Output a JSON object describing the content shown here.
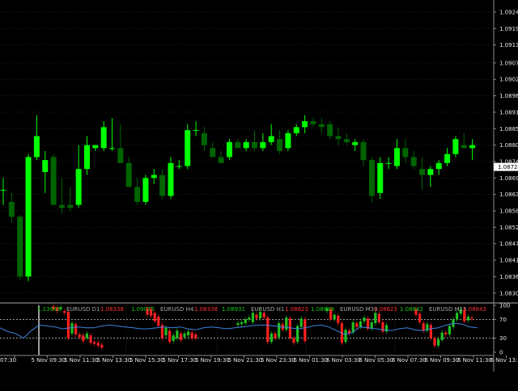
{
  "colors": {
    "background": "#000000",
    "grid": "#3a4a3a",
    "axis": "#8a8a8a",
    "bull": "#00ff00",
    "bear": "#006400",
    "current_price_bg": "#ffffff",
    "current_price_text": "#000000",
    "osc_line": "#3f82e0",
    "osc_level": "#cfcfcf",
    "ind_up": "#ff2020",
    "ind_down": "#20c020",
    "cursor_line": "#9a9a9a",
    "label_grey": "#a8a8a8",
    "label_red": "#ff3030",
    "label_green": "#19c819"
  },
  "price_axis": {
    "labels": [
      "1.09245",
      "1.09190",
      "1.09135",
      "1.09075",
      "1.09020",
      "1.08965",
      "1.08910",
      "1.08855",
      "1.08800",
      "1.08745",
      "1.08690",
      "1.08635",
      "1.08580",
      "1.08525",
      "1.08470",
      "1.08415",
      "1.08360",
      "1.08305"
    ],
    "current_price": "1.08727"
  },
  "oscillator_axis": {
    "labels": [
      "100",
      "70",
      "30",
      "0"
    ],
    "levels": [
      70,
      30
    ]
  },
  "time_axis": {
    "labels": [
      "07:30",
      "5 Nov 09:30",
      "5 Nov 11:30",
      "5 Nov 13:30",
      "5 Nov 15:30",
      "5 Nov 17:30",
      "5 Nov 19:30",
      "5 Nov 21:30",
      "5 Nov 23:30",
      "6 Nov 01:30",
      "6 Nov 03:30",
      "6 Nov 05:30",
      "6 Nov 07:30",
      "6 Nov 09:30",
      "6 Nov 11:30",
      "6 Nov 13:30"
    ]
  },
  "timeframe_panels": [
    {
      "v1": "1.13945",
      "v1_color": "label_green",
      "name": "EURUSD D1",
      "v2": "1.08338",
      "v2_color": "label_red"
    },
    {
      "v1": "1.09075",
      "v1_color": "label_green",
      "name": "EURUSD H4",
      "v2": "1.08338",
      "v2_color": "label_red"
    },
    {
      "v1": "1.08931",
      "v1_color": "label_green",
      "name": "EURUSD H1",
      "v2": "1.08623",
      "v2_color": "label_red"
    },
    {
      "v1": "1.08849",
      "v1_color": "label_green",
      "name": "EURUSD M30",
      "v2": "1.08623",
      "v2_color": "label_red"
    },
    {
      "v1": "1.08842",
      "v1_color": "label_green",
      "name": "EURUSD M15",
      "v2": "1.08643",
      "v2_color": "label_red"
    }
  ],
  "chart_data": {
    "type": "candlestick",
    "symbol": "EURUSD",
    "timeframe": "M15",
    "ylim": [
      1.0828,
      1.0928
    ],
    "candles": [
      {
        "o": 1.0865,
        "h": 1.0869,
        "l": 1.086,
        "c": 1.0865
      },
      {
        "o": 1.0861,
        "h": 1.0864,
        "l": 1.0854,
        "c": 1.0856
      },
      {
        "o": 1.0856,
        "h": 1.08565,
        "l": 1.0835,
        "c": 1.0836
      },
      {
        "o": 1.0836,
        "h": 1.0877,
        "l": 1.08345,
        "c": 1.0876
      },
      {
        "o": 1.0876,
        "h": 1.089,
        "l": 1.0875,
        "c": 1.0883
      },
      {
        "o": 1.0871,
        "h": 1.0878,
        "l": 1.0864,
        "c": 1.0875
      },
      {
        "o": 1.0876,
        "h": 1.0877,
        "l": 1.086,
        "c": 1.086
      },
      {
        "o": 1.086,
        "h": 1.0869,
        "l": 1.0857,
        "c": 1.0859
      },
      {
        "o": 1.086,
        "h": 1.0866,
        "l": 1.0858,
        "c": 1.0859
      },
      {
        "o": 1.086,
        "h": 1.088,
        "l": 1.0859,
        "c": 1.0872
      },
      {
        "o": 1.0872,
        "h": 1.0883,
        "l": 1.087,
        "c": 1.088
      },
      {
        "o": 1.0879,
        "h": 1.088,
        "l": 1.0878,
        "c": 1.088
      },
      {
        "o": 1.0879,
        "h": 1.0888,
        "l": 1.0878,
        "c": 1.0886
      },
      {
        "o": 1.0879,
        "h": 1.0889,
        "l": 1.0878,
        "c": 1.0879
      },
      {
        "o": 1.0879,
        "h": 1.0887,
        "l": 1.0875,
        "c": 1.0874
      },
      {
        "o": 1.0874,
        "h": 1.0876,
        "l": 1.0868,
        "c": 1.0866
      },
      {
        "o": 1.0866,
        "h": 1.0869,
        "l": 1.086,
        "c": 1.0861
      },
      {
        "o": 1.0861,
        "h": 1.087,
        "l": 1.086,
        "c": 1.0869
      },
      {
        "o": 1.0869,
        "h": 1.0872,
        "l": 1.0867,
        "c": 1.087
      },
      {
        "o": 1.087,
        "h": 1.0872,
        "l": 1.0862,
        "c": 1.0863
      },
      {
        "o": 1.0863,
        "h": 1.0876,
        "l": 1.0862,
        "c": 1.0874
      },
      {
        "o": 1.0873,
        "h": 1.0875,
        "l": 1.0872,
        "c": 1.0873
      },
      {
        "o": 1.0873,
        "h": 1.0887,
        "l": 1.0872,
        "c": 1.0885
      },
      {
        "o": 1.0885,
        "h": 1.0888,
        "l": 1.0883,
        "c": 1.0885
      },
      {
        "o": 1.0884,
        "h": 1.0886,
        "l": 1.0878,
        "c": 1.088
      },
      {
        "o": 1.0879,
        "h": 1.0881,
        "l": 1.0876,
        "c": 1.0876
      },
      {
        "o": 1.0876,
        "h": 1.0878,
        "l": 1.0874,
        "c": 1.0874
      },
      {
        "o": 1.0876,
        "h": 1.0882,
        "l": 1.0875,
        "c": 1.0881
      },
      {
        "o": 1.0881,
        "h": 1.0882,
        "l": 1.0879,
        "c": 1.0879
      },
      {
        "o": 1.0879,
        "h": 1.0882,
        "l": 1.0878,
        "c": 1.0881
      },
      {
        "o": 1.0881,
        "h": 1.0885,
        "l": 1.0878,
        "c": 1.0879
      },
      {
        "o": 1.0879,
        "h": 1.0884,
        "l": 1.0878,
        "c": 1.0881
      },
      {
        "o": 1.0881,
        "h": 1.0887,
        "l": 1.088,
        "c": 1.0883
      },
      {
        "o": 1.0882,
        "h": 1.0885,
        "l": 1.0877,
        "c": 1.0878
      },
      {
        "o": 1.0879,
        "h": 1.0885,
        "l": 1.0878,
        "c": 1.0884
      },
      {
        "o": 1.0884,
        "h": 1.0887,
        "l": 1.0883,
        "c": 1.0886
      },
      {
        "o": 1.0886,
        "h": 1.089,
        "l": 1.0884,
        "c": 1.0888
      },
      {
        "o": 1.0888,
        "h": 1.0889,
        "l": 1.0886,
        "c": 1.0887
      },
      {
        "o": 1.0887,
        "h": 1.0889,
        "l": 1.0884,
        "c": 1.0886
      },
      {
        "o": 1.0887,
        "h": 1.0888,
        "l": 1.0882,
        "c": 1.0883
      },
      {
        "o": 1.0883,
        "h": 1.0886,
        "l": 1.088,
        "c": 1.0882
      },
      {
        "o": 1.0882,
        "h": 1.0884,
        "l": 1.088,
        "c": 1.0881
      },
      {
        "o": 1.088,
        "h": 1.0882,
        "l": 1.0878,
        "c": 1.0881
      },
      {
        "o": 1.0881,
        "h": 1.0882,
        "l": 1.0873,
        "c": 1.0875
      },
      {
        "o": 1.0875,
        "h": 1.0876,
        "l": 1.0861,
        "c": 1.0863
      },
      {
        "o": 1.0864,
        "h": 1.0876,
        "l": 1.0862,
        "c": 1.0874
      },
      {
        "o": 1.0874,
        "h": 1.0876,
        "l": 1.0872,
        "c": 1.0874
      },
      {
        "o": 1.0873,
        "h": 1.0882,
        "l": 1.0872,
        "c": 1.0879
      },
      {
        "o": 1.0879,
        "h": 1.0882,
        "l": 1.0874,
        "c": 1.0876
      },
      {
        "o": 1.0876,
        "h": 1.0878,
        "l": 1.0872,
        "c": 1.0873
      },
      {
        "o": 1.0872,
        "h": 1.0876,
        "l": 1.0865,
        "c": 1.087
      },
      {
        "o": 1.087,
        "h": 1.0873,
        "l": 1.0866,
        "c": 1.0872
      },
      {
        "o": 1.0872,
        "h": 1.0875,
        "l": 1.087,
        "c": 1.0874
      },
      {
        "o": 1.0874,
        "h": 1.0879,
        "l": 1.0873,
        "c": 1.0877
      },
      {
        "o": 1.0877,
        "h": 1.0883,
        "l": 1.0876,
        "c": 1.0882
      },
      {
        "o": 1.088,
        "h": 1.0884,
        "l": 1.0879,
        "c": 1.0879
      },
      {
        "o": 1.0879,
        "h": 1.0882,
        "l": 1.0875,
        "c": 1.088
      }
    ],
    "oscillator": {
      "ylim": [
        0,
        100
      ],
      "values": [
        52,
        44,
        40,
        30,
        46,
        58,
        56,
        54,
        50,
        52,
        54,
        52,
        52,
        56,
        58,
        56,
        54,
        52,
        50,
        50,
        52,
        54,
        52,
        54,
        50,
        48,
        52,
        54,
        52,
        50,
        52,
        54,
        56,
        58,
        58,
        56,
        54,
        52,
        50,
        52,
        56,
        58,
        54,
        46,
        38,
        42,
        54,
        52,
        50,
        48,
        46,
        50,
        52,
        48,
        46,
        50,
        52,
        58,
        62,
        60,
        54,
        52
      ]
    },
    "panels": [
      {
        "bars": [
          {
            "o": 98,
            "c": 92
          },
          {
            "o": 95,
            "c": 88
          },
          {
            "o": 92,
            "c": 96
          },
          {
            "o": 88,
            "c": 84
          },
          {
            "o": 86,
            "c": 30
          },
          {
            "o": 40,
            "c": 62
          },
          {
            "o": 60,
            "c": 38
          },
          {
            "o": 38,
            "c": 32
          },
          {
            "o": 36,
            "c": 24
          },
          {
            "o": 30,
            "c": 40
          },
          {
            "o": 36,
            "c": 20
          },
          {
            "o": 22,
            "c": 18
          },
          {
            "o": 20,
            "c": 14
          },
          {
            "o": 16,
            "c": 10
          }
        ]
      },
      {
        "bars": [
          {
            "o": 94,
            "c": 80
          },
          {
            "o": 92,
            "c": 78
          },
          {
            "o": 84,
            "c": 66
          },
          {
            "o": 76,
            "c": 56
          },
          {
            "o": 58,
            "c": 30
          },
          {
            "o": 36,
            "c": 52
          },
          {
            "o": 46,
            "c": 22
          },
          {
            "o": 24,
            "c": 36
          },
          {
            "o": 30,
            "c": 46
          },
          {
            "o": 40,
            "c": 26
          },
          {
            "o": 32,
            "c": 40
          },
          {
            "o": 36,
            "c": 44
          },
          {
            "o": 42,
            "c": 30
          },
          {
            "o": 38,
            "c": 30
          }
        ]
      },
      {
        "bars": [
          {
            "o": 58,
            "c": 62
          },
          {
            "o": 60,
            "c": 64
          },
          {
            "o": 62,
            "c": 70
          },
          {
            "o": 70,
            "c": 74
          },
          {
            "o": 64,
            "c": 84
          },
          {
            "o": 80,
            "c": 72
          },
          {
            "o": 72,
            "c": 86
          },
          {
            "o": 84,
            "c": 74
          },
          {
            "o": 74,
            "c": 22
          },
          {
            "o": 22,
            "c": 40
          },
          {
            "o": 40,
            "c": 30
          },
          {
            "o": 32,
            "c": 62
          },
          {
            "o": 60,
            "c": 48
          },
          {
            "o": 48,
            "c": 74
          },
          {
            "o": 72,
            "c": 30
          },
          {
            "o": 30,
            "c": 20
          },
          {
            "o": 22,
            "c": 56
          },
          {
            "o": 54,
            "c": 72
          },
          {
            "o": 70,
            "c": 24
          }
        ]
      },
      {
        "bars": [
          {
            "o": 88,
            "c": 94
          },
          {
            "o": 92,
            "c": 70
          },
          {
            "o": 70,
            "c": 80
          },
          {
            "o": 78,
            "c": 62
          },
          {
            "o": 62,
            "c": 20
          },
          {
            "o": 22,
            "c": 48
          },
          {
            "o": 46,
            "c": 40
          },
          {
            "o": 42,
            "c": 64
          },
          {
            "o": 62,
            "c": 54
          },
          {
            "o": 54,
            "c": 66
          },
          {
            "o": 66,
            "c": 74
          },
          {
            "o": 72,
            "c": 50
          },
          {
            "o": 50,
            "c": 64
          },
          {
            "o": 62,
            "c": 84
          },
          {
            "o": 82,
            "c": 64
          },
          {
            "o": 64,
            "c": 44
          },
          {
            "o": 44,
            "c": 58
          }
        ]
      },
      {
        "bars": [
          {
            "o": 92,
            "c": 80
          },
          {
            "o": 82,
            "c": 64
          },
          {
            "o": 62,
            "c": 46
          },
          {
            "o": 46,
            "c": 60
          },
          {
            "o": 58,
            "c": 30
          },
          {
            "o": 30,
            "c": 14
          },
          {
            "o": 14,
            "c": 28
          },
          {
            "o": 26,
            "c": 42
          },
          {
            "o": 42,
            "c": 38
          },
          {
            "o": 38,
            "c": 56
          },
          {
            "o": 54,
            "c": 70
          },
          {
            "o": 70,
            "c": 84
          },
          {
            "o": 82,
            "c": 92
          },
          {
            "o": 90,
            "c": 66
          },
          {
            "o": 68,
            "c": 76
          },
          {
            "o": 74,
            "c": 72
          }
        ]
      }
    ]
  }
}
